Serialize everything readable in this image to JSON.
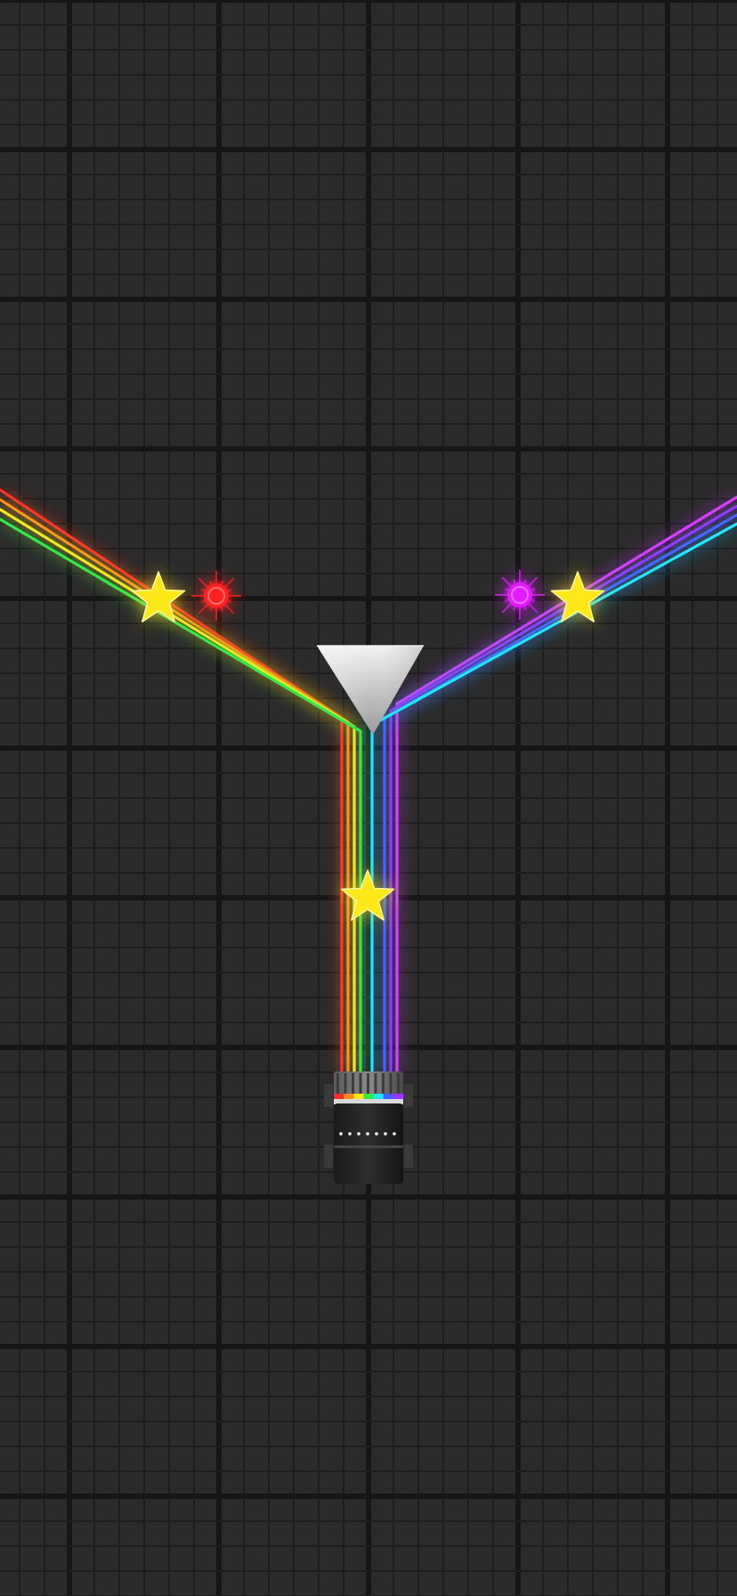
{
  "game": {
    "name": "light-beam-puzzle",
    "background_color": "#2b2b2b",
    "grid": {
      "minor_color": "#1d1d1d",
      "major_color": "#161616"
    },
    "beam_colors": {
      "red": "#ff2a2a",
      "orange": "#ff8c1a",
      "yellow": "#ffe81a",
      "green": "#32e84a",
      "cyan": "#22e6ff",
      "blue": "#4a5cff",
      "purple": "#9a34ff",
      "magenta": "#e23cff"
    },
    "left_beam_group": [
      "red",
      "orange",
      "yellow",
      "green"
    ],
    "right_beam_group": [
      "magenta",
      "purple",
      "blue",
      "cyan"
    ],
    "stars": [
      {
        "id": "star-left",
        "color": "#ffe81a",
        "collected": false
      },
      {
        "id": "star-right",
        "color": "#ffe81a",
        "collected": false
      },
      {
        "id": "star-center",
        "color": "#ffe81a",
        "collected": false
      }
    ],
    "targets": [
      {
        "id": "red-target",
        "color": "#ff2020",
        "icon": "sparkle-icon"
      },
      {
        "id": "magenta-target",
        "color": "#e21cff",
        "icon": "sparkle-icon"
      }
    ],
    "splitter": {
      "icon": "prism-icon",
      "color": "#d8d8d8"
    },
    "emitter": {
      "icon": "light-emitter-icon",
      "stripe_colors": [
        "#ff2a2a",
        "#ff8c1a",
        "#ffe81a",
        "#32e84a",
        "#22e6ff",
        "#4a5cff",
        "#9a34ff"
      ]
    }
  }
}
